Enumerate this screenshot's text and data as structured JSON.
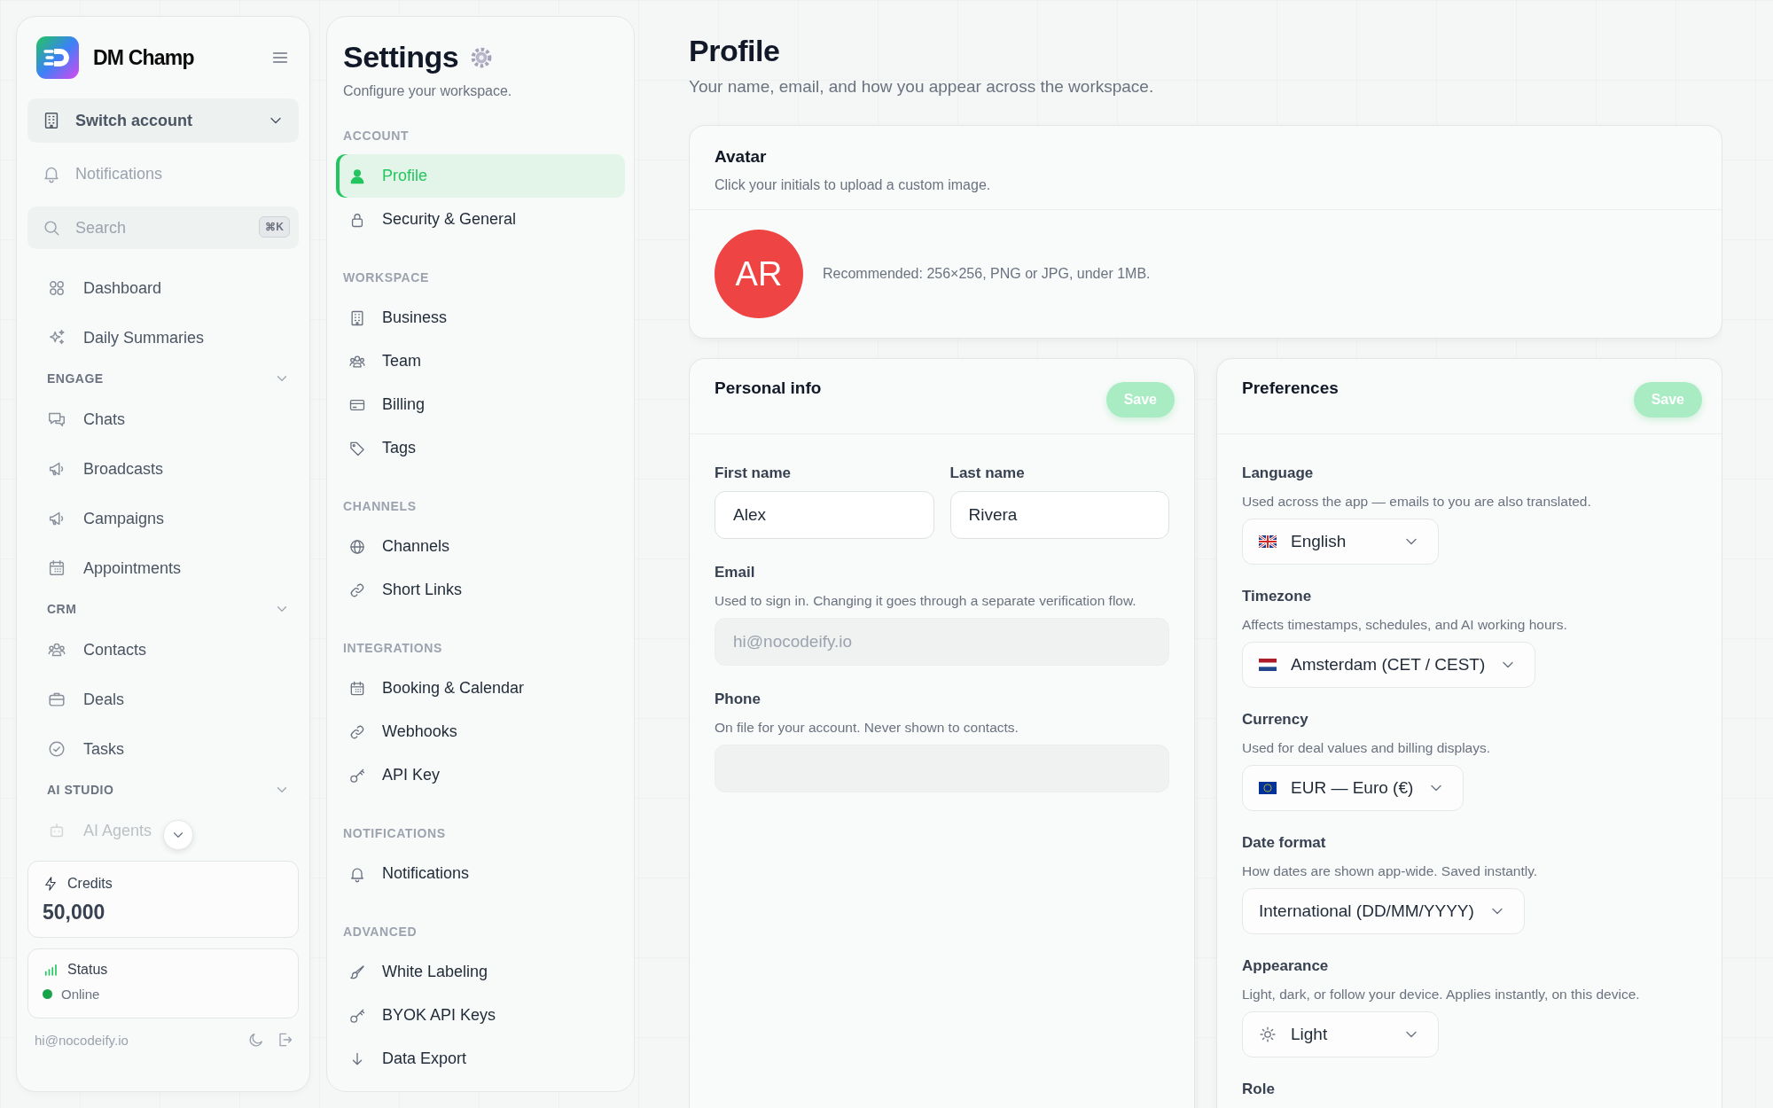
{
  "brand": {
    "name": "DM Champ"
  },
  "sidebar": {
    "account_switcher": "Switch account",
    "notifications": "Notifications",
    "search": {
      "placeholder": "Search",
      "shortcut": "⌘K"
    },
    "top_items": [
      "Dashboard",
      "Daily Summaries"
    ],
    "sections": [
      {
        "title": "ENGAGE",
        "expanded": true,
        "items": [
          "Chats",
          "Broadcasts",
          "Campaigns",
          "Appointments"
        ]
      },
      {
        "title": "CRM",
        "expanded": true,
        "items": [
          "Contacts",
          "Deals",
          "Tasks"
        ]
      },
      {
        "title": "AI STUDIO",
        "expanded": true,
        "items": [
          "AI Agents"
        ]
      }
    ],
    "credits": {
      "label": "Credits",
      "value": "50,000"
    },
    "status": {
      "label": "Status",
      "value": "Online",
      "online": true
    },
    "user_email": "hi@nocodeify.io"
  },
  "settings_nav": {
    "title": "Settings",
    "subtitle": "Configure your workspace.",
    "groups": [
      {
        "title": "ACCOUNT",
        "items": [
          {
            "label": "Profile",
            "selected": true
          },
          {
            "label": "Security & General",
            "selected": false
          }
        ]
      },
      {
        "title": "WORKSPACE",
        "items": [
          {
            "label": "Business",
            "selected": false
          },
          {
            "label": "Team",
            "selected": false
          },
          {
            "label": "Billing",
            "selected": false
          },
          {
            "label": "Tags",
            "selected": false
          }
        ]
      },
      {
        "title": "CHANNELS",
        "items": [
          {
            "label": "Channels",
            "selected": false
          },
          {
            "label": "Short Links",
            "selected": false
          }
        ]
      },
      {
        "title": "INTEGRATIONS",
        "items": [
          {
            "label": "Booking & Calendar",
            "selected": false
          },
          {
            "label": "Webhooks",
            "selected": false
          },
          {
            "label": "API Key",
            "selected": false
          }
        ]
      },
      {
        "title": "NOTIFICATIONS",
        "items": [
          {
            "label": "Notifications",
            "selected": false
          }
        ]
      },
      {
        "title": "ADVANCED",
        "items": [
          {
            "label": "White Labeling",
            "selected": false
          },
          {
            "label": "BYOK API Keys",
            "selected": false
          },
          {
            "label": "Data Export",
            "selected": false
          }
        ]
      }
    ]
  },
  "page": {
    "title": "Profile",
    "subtitle": "Your name, email, and how you appear across the workspace."
  },
  "avatar_card": {
    "title": "Avatar",
    "description": "Click your initials to upload a custom image.",
    "initials": "AR",
    "note": "Recommended: 256×256, PNG or JPG, under 1MB."
  },
  "personal_info": {
    "title": "Personal info",
    "save": {
      "label": "Save",
      "disabled": true
    },
    "fields": [
      {
        "label": "First name",
        "value": "Alex",
        "disabled": false
      },
      {
        "label": "Last name",
        "value": "Rivera",
        "disabled": false
      },
      {
        "label": "Email",
        "help": "Used to sign in. Changing it goes through a separate verification flow.",
        "value": "hi@nocodeify.io",
        "disabled": true
      },
      {
        "label": "Phone",
        "help": "On file for your account. Never shown to contacts.",
        "disabled": true
      }
    ]
  },
  "preferences": {
    "title": "Preferences",
    "save": {
      "label": "Save",
      "disabled": true
    },
    "fields": [
      {
        "label": "Language",
        "help": "Used across the app — emails to you are also translated.",
        "value": "English"
      },
      {
        "label": "Timezone",
        "help": "Affects timestamps, schedules, and AI working hours.",
        "value": "Amsterdam (CET / CEST)"
      },
      {
        "label": "Currency",
        "help": "Used for deal values and billing displays.",
        "value": "EUR — Euro (€)"
      },
      {
        "label": "Date format",
        "help": "How dates are shown app-wide. Saved instantly.",
        "value": "International (DD/MM/YYYY)"
      },
      {
        "label": "Appearance",
        "help": "Light, dark, or follow your device. Applies instantly, on this device.",
        "value": "Light"
      },
      {
        "label": "Role"
      }
    ]
  }
}
